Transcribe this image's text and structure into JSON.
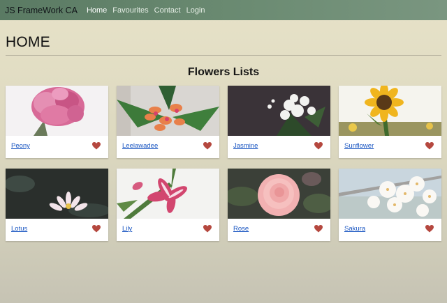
{
  "nav": {
    "brand": "JS FrameWork CA",
    "links": [
      "Home",
      "Favourites",
      "Contact",
      "Login"
    ],
    "active": "Home"
  },
  "page": {
    "title": "HOME",
    "section_title": "Flowers Lists"
  },
  "flowers": [
    {
      "name": "Peony"
    },
    {
      "name": "Leelawadee"
    },
    {
      "name": "Jasmine"
    },
    {
      "name": "Sunflower"
    },
    {
      "name": "Lotus"
    },
    {
      "name": "Lily"
    },
    {
      "name": "Rose"
    },
    {
      "name": "Sakura"
    }
  ],
  "colors": {
    "heart": "#b5483f",
    "link": "#1a56c2",
    "navbar": "#5a7a63"
  },
  "icons": {
    "favourite": "heart-icon"
  }
}
